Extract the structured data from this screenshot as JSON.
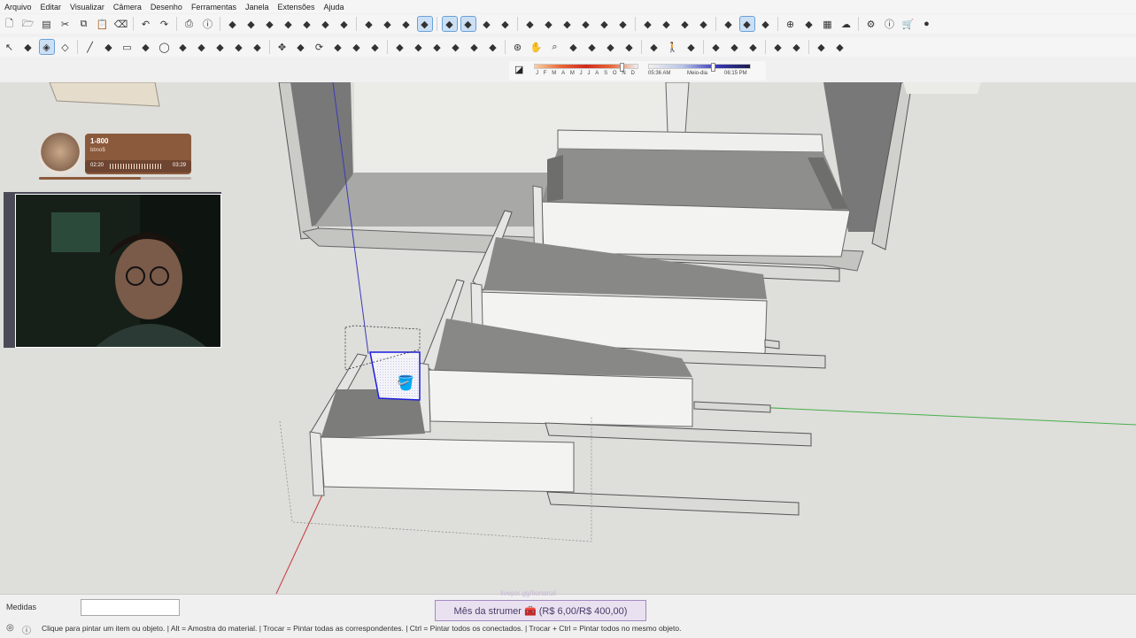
{
  "menu": [
    "Arquivo",
    "Editar",
    "Visualizar",
    "Câmera",
    "Desenho",
    "Ferramentas",
    "Janela",
    "Extensões",
    "Ajuda"
  ],
  "toolbar_row1": [
    "new-file-icon",
    "open-folder-icon",
    "save-icon",
    "cut-icon",
    "copy-icon",
    "paste-icon",
    "erase-icon",
    "|",
    "undo-icon",
    "redo-icon",
    "|",
    "print-icon",
    "model-info-icon",
    "|",
    "iso-view-icon",
    "top-view-icon",
    "front-view-icon",
    "right-view-icon",
    "back-view-icon",
    "left-view-icon",
    "bottom-view-icon",
    "|",
    "xray-icon",
    "wireframe-icon",
    "hidden-line-icon",
    "shaded-icon",
    "|",
    "section-plane-icon",
    "section-display-icon",
    "section-cut-icon",
    "section-fill-icon",
    "|",
    "outer-shell-icon",
    "intersect-icon",
    "union-icon",
    "subtract-icon",
    "trim-icon",
    "split-icon",
    "|",
    "geo-location-icon",
    "add-location-icon",
    "terrain-icon",
    "photo-texture-icon",
    "|",
    "warehouse-icon",
    "share-model-icon",
    "extension-warehouse-icon",
    "|",
    "add-icon",
    "ruby-icon",
    "chess-icon",
    "cloud-icon",
    "|",
    "settings-icon",
    "info-icon",
    "cart-icon",
    "user-icon"
  ],
  "toolbar_row2": [
    "select-icon",
    "component-icon",
    "paint-bucket-icon",
    "eraser-icon",
    "|",
    "line-icon",
    "freehand-icon",
    "rectangle-icon",
    "rotated-rect-icon",
    "circle-icon",
    "polygon-icon",
    "arc-icon",
    "two-point-arc-icon",
    "three-point-arc-icon",
    "pie-icon",
    "|",
    "move-icon",
    "push-pull-icon",
    "rotate-icon",
    "scale-icon",
    "offset-icon",
    "follow-me-icon",
    "|",
    "tape-measure-icon",
    "dimension-icon",
    "protractor-icon",
    "text-icon",
    "axes-icon",
    "3d-text-icon",
    "|",
    "orbit-icon",
    "pan-icon",
    "zoom-icon",
    "zoom-window-icon",
    "zoom-extents-icon",
    "previous-view-icon",
    "next-view-icon",
    "|",
    "position-camera-icon",
    "walk-icon",
    "look-around-icon",
    "|",
    "sandbox-icon",
    "box-icon",
    "solid-icon",
    "|",
    "mirror-icon",
    "curve-icon",
    "|",
    "dimension-tool-icon",
    "layout-icon"
  ],
  "shadow_bar": {
    "months": [
      "J",
      "F",
      "M",
      "A",
      "M",
      "J",
      "J",
      "A",
      "S",
      "O",
      "N",
      "D"
    ],
    "time_start": "05:36 AM",
    "time_mid": "Meio-dia",
    "time_end": "06:15 PM"
  },
  "music_widget": {
    "title": "1-800",
    "artist": "bbno$",
    "current_time": "02:20",
    "total_time": "03:29",
    "progress": 0.67
  },
  "status": {
    "measures_label": "Medidas",
    "measures_value": "",
    "banner": "Mês da strumer 🧰 (R$ 6,00/R$ 400,00)",
    "overlay_text": "livepix.gg/lionaruii",
    "hint": "Clique para pintar um item ou objeto. | Alt = Amostra do material. | Trocar = Pintar todas as correspondentes. | Ctrl = Pintar todos os conectados. | Trocar + Ctrl = Pintar todos no mesmo objeto."
  },
  "icons": {
    "cursor": "paint-bucket-cursor-icon",
    "status_info": "info-icon",
    "status_geo": "geo-location-icon"
  },
  "colors": {
    "accent": "#4a8fd6",
    "viewport_bg": "#dededb",
    "green_axis": "#49b04a",
    "red_axis": "#c8383a",
    "blue_axis": "#3a3ab8"
  }
}
